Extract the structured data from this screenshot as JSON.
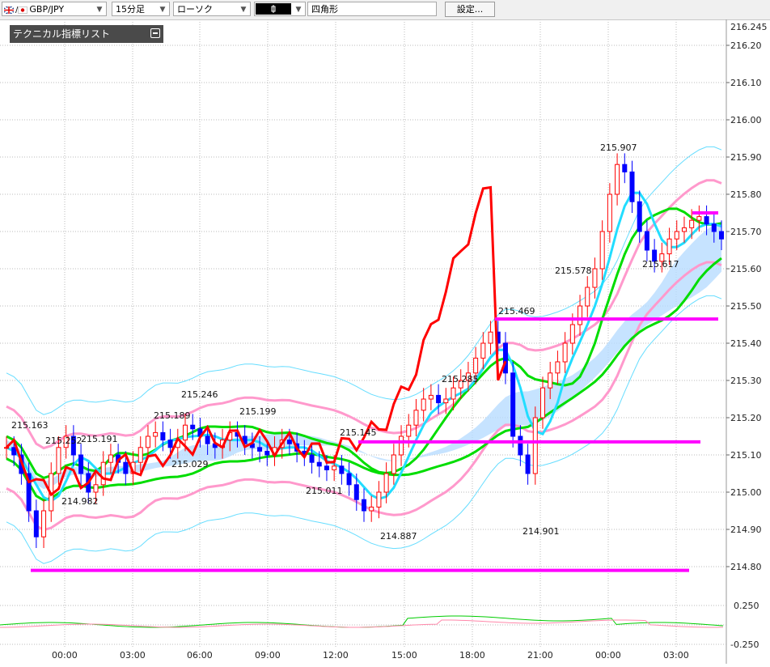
{
  "toolbar": {
    "symbol": "GBP/JPY",
    "timeframe": "15分足",
    "chart_style": "ローソク",
    "draw_tool": "四角形",
    "settings_label": "設定..."
  },
  "indicator_list": {
    "title": "テクニカル指標リスト"
  },
  "colors": {
    "candle_up": "#ff0000",
    "candle_down": "#0000ff",
    "bb_outer": "#66ddff",
    "bb_inner": "#ff99cc",
    "ma_green": "#00dd00",
    "ma_cyan": "#22ddff",
    "rsi_red": "#ff0000",
    "level_magenta": "#ff00ff",
    "cloud": "#b8dcff"
  },
  "chart_data": {
    "type": "candlestick",
    "symbol": "GBP/JPY",
    "timeframe": "15分足",
    "y_axis": {
      "range": [
        214.73,
        216.245
      ],
      "top_label": "216.245",
      "ticks": [
        "216.20",
        "216.10",
        "216.00",
        "215.90",
        "215.80",
        "215.70",
        "215.60",
        "215.50",
        "215.40",
        "215.30",
        "215.20",
        "215.10",
        "215.00",
        "214.90",
        "214.80"
      ]
    },
    "x_axis": {
      "ticks": [
        "00:00",
        "03:00",
        "06:00",
        "09:00",
        "12:00",
        "15:00",
        "18:00",
        "21:00",
        "00:00",
        "03:00"
      ]
    },
    "price_annotations": [
      "215.163",
      "215.252",
      "215.191",
      "214.982",
      "215.189",
      "215.246",
      "215.029",
      "215.199",
      "215.011",
      "215.145",
      "214.887",
      "215.285",
      "215.469",
      "215.578",
      "214.901",
      "215.907",
      "215.617"
    ],
    "horizontal_levels": [
      {
        "value": 215.465,
        "note": "magenta"
      },
      {
        "value": 215.135,
        "note": "magenta"
      },
      {
        "value": 214.79,
        "note": "magenta"
      },
      {
        "value": 215.75,
        "note": "magenta"
      }
    ],
    "sub_panel": {
      "ticks": [
        "0.250",
        "-0.250"
      ]
    },
    "ohlc_path": [
      215.12,
      215.1,
      215.05,
      214.95,
      214.88,
      214.95,
      215.05,
      215.12,
      215.15,
      215.1,
      215.05,
      215.0,
      215.02,
      215.08,
      215.1,
      215.08,
      215.05,
      215.08,
      215.12,
      215.15,
      215.16,
      215.14,
      215.12,
      215.14,
      215.18,
      215.17,
      215.15,
      215.13,
      215.12,
      215.14,
      215.16,
      215.15,
      215.13,
      215.12,
      215.11,
      215.1,
      215.12,
      215.14,
      215.13,
      215.11,
      215.1,
      215.08,
      215.07,
      215.06,
      215.07,
      215.05,
      215.02,
      214.98,
      214.95,
      214.96,
      215.0,
      215.05,
      215.1,
      215.15,
      215.18,
      215.22,
      215.25,
      215.26,
      215.24,
      215.25,
      215.28,
      215.3,
      215.32,
      215.36,
      215.4,
      215.43,
      215.4,
      215.32,
      215.15,
      215.1,
      215.05,
      215.2,
      215.28,
      215.32,
      215.35,
      215.4,
      215.45,
      215.5,
      215.55,
      215.6,
      215.7,
      215.8,
      215.88,
      215.86,
      215.78,
      215.7,
      215.65,
      215.62,
      215.64,
      215.68,
      215.7,
      215.71,
      215.73,
      215.74,
      215.72,
      215.7,
      215.68
    ]
  }
}
